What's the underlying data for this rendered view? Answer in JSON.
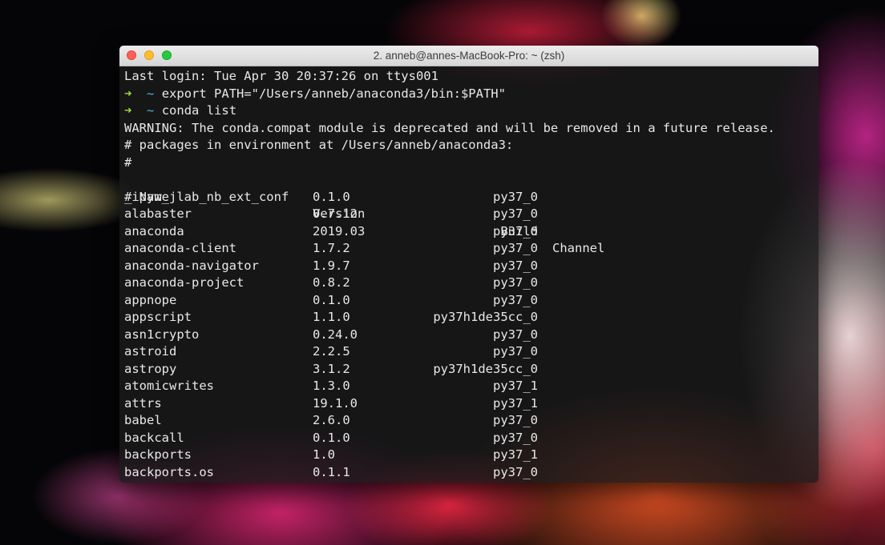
{
  "window": {
    "title": "2. anneb@annes-MacBook-Pro: ~ (zsh)"
  },
  "terminal": {
    "last_login": "Last login: Tue Apr 30 20:37:26 on ttys001",
    "prompt_arrow": "➜",
    "prompt_dir": "~",
    "commands": [
      "export PATH=\"/Users/anneb/anaconda3/bin:$PATH\"",
      "conda list"
    ],
    "warning": "WARNING: The conda.compat module is deprecated and will be removed in a future release.",
    "env_header": "# packages in environment at /Users/anneb/anaconda3:",
    "hash_line": "#",
    "columns": {
      "name": "# Name",
      "version": "Version",
      "build": "Build",
      "channel": "Channel"
    },
    "packages": [
      {
        "name": "_ipyw_jlab_nb_ext_conf",
        "version": "0.1.0",
        "build": "py37_0"
      },
      {
        "name": "alabaster",
        "version": "0.7.12",
        "build": "py37_0"
      },
      {
        "name": "anaconda",
        "version": "2019.03",
        "build": "py37_0"
      },
      {
        "name": "anaconda-client",
        "version": "1.7.2",
        "build": "py37_0"
      },
      {
        "name": "anaconda-navigator",
        "version": "1.9.7",
        "build": "py37_0"
      },
      {
        "name": "anaconda-project",
        "version": "0.8.2",
        "build": "py37_0"
      },
      {
        "name": "appnope",
        "version": "0.1.0",
        "build": "py37_0"
      },
      {
        "name": "appscript",
        "version": "1.1.0",
        "build": "py37h1de35cc_0"
      },
      {
        "name": "asn1crypto",
        "version": "0.24.0",
        "build": "py37_0"
      },
      {
        "name": "astroid",
        "version": "2.2.5",
        "build": "py37_0"
      },
      {
        "name": "astropy",
        "version": "3.1.2",
        "build": "py37h1de35cc_0"
      },
      {
        "name": "atomicwrites",
        "version": "1.3.0",
        "build": "py37_1"
      },
      {
        "name": "attrs",
        "version": "19.1.0",
        "build": "py37_1"
      },
      {
        "name": "babel",
        "version": "2.6.0",
        "build": "py37_0"
      },
      {
        "name": "backcall",
        "version": "0.1.0",
        "build": "py37_0"
      },
      {
        "name": "backports",
        "version": "1.0",
        "build": "py37_1"
      },
      {
        "name": "backports.os",
        "version": "0.1.1",
        "build": "py37_0"
      }
    ]
  },
  "colors": {
    "prompt_arrow": "#9ee03a",
    "prompt_dir": "#4fb3d4",
    "text": "#e8e8e8",
    "close_button": "#fe5f57",
    "minimize_button": "#febc2e",
    "zoom_button": "#28c840"
  }
}
